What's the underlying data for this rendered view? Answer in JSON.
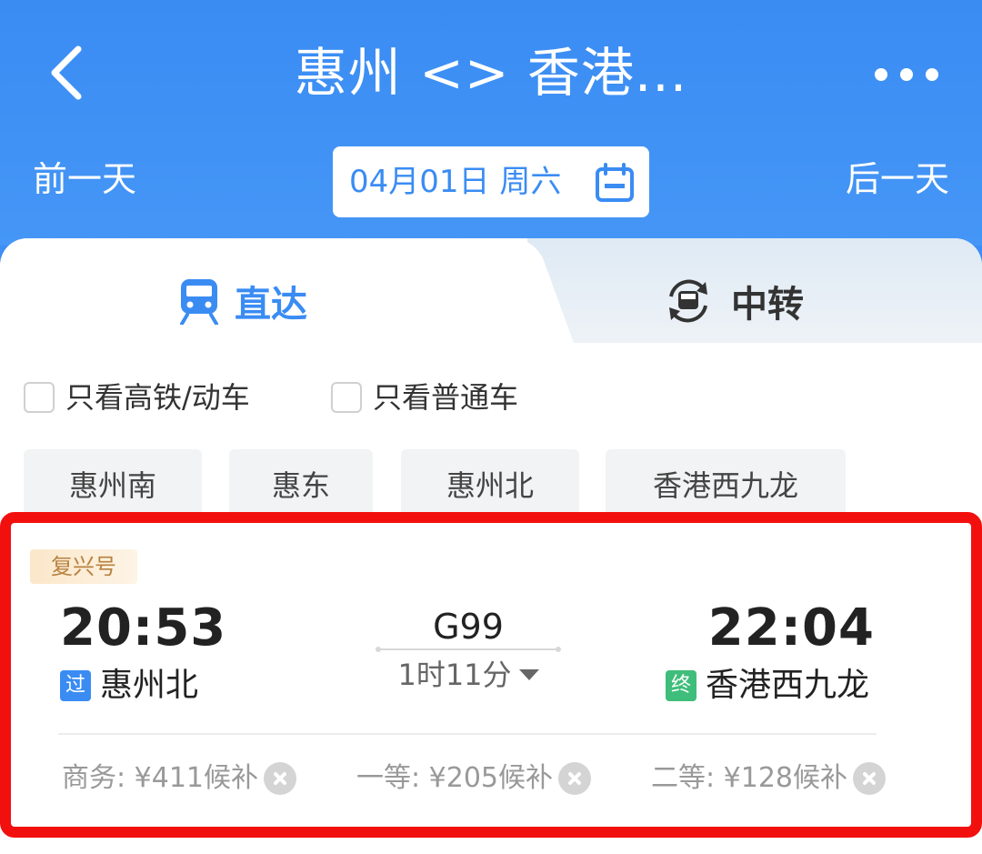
{
  "header": {
    "title": "惠州 <> 香港...",
    "prev_day": "前一天",
    "next_day": "后一天",
    "date": "04月01日 周六"
  },
  "tabs": {
    "direct": "直达",
    "transfer": "中转"
  },
  "filters": [
    {
      "label": "只看高铁/动车",
      "checked": false
    },
    {
      "label": "只看普通车",
      "checked": false
    }
  ],
  "stations": [
    "惠州南",
    "惠东",
    "惠州北",
    "香港西九龙"
  ],
  "train": {
    "badge": "复兴号",
    "number": "G99",
    "duration": "1时11分",
    "departure_time": "20:53",
    "departure_tag": "过",
    "departure_station": "惠州北",
    "arrival_time": "22:04",
    "arrival_tag": "终",
    "arrival_station": "香港西九龙",
    "fares": [
      {
        "label": "商务: ¥411候补"
      },
      {
        "label": "一等: ¥205候补"
      },
      {
        "label": "二等: ¥128候补"
      }
    ]
  },
  "colors": {
    "primary": "#3a8cf3",
    "highlight_frame": "#f2100f",
    "end_tag": "#3fbd7a",
    "badge_text": "#b7823f"
  }
}
